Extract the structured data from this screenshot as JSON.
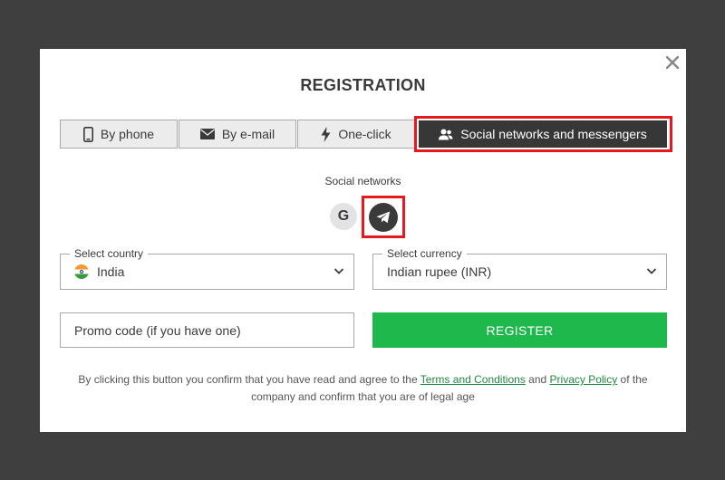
{
  "modal": {
    "title": "REGISTRATION",
    "close_icon": "close-icon"
  },
  "tabs": [
    {
      "label": "By phone",
      "icon": "phone-icon"
    },
    {
      "label": "By e-mail",
      "icon": "envelope-icon"
    },
    {
      "label": "One-click",
      "icon": "lightning-icon"
    },
    {
      "label": "Social networks and messengers",
      "icon": "users-icon",
      "active": true
    }
  ],
  "social": {
    "label": "Social networks",
    "buttons": [
      {
        "name": "google",
        "glyph": "G"
      },
      {
        "name": "telegram",
        "icon": "telegram-icon"
      }
    ]
  },
  "country": {
    "legend": "Select country",
    "value": "India"
  },
  "currency": {
    "legend": "Select currency",
    "value": "Indian rupee (INR)"
  },
  "promo": {
    "placeholder": "Promo code (if you have one)"
  },
  "register": {
    "label": "REGISTER"
  },
  "terms": {
    "before": "By clicking this button you confirm that you have read and agree to the ",
    "terms_link": "Terms and Conditions",
    "middle": " and ",
    "privacy_link": "Privacy Policy",
    "after": " of the company and confirm that you are of legal age"
  },
  "colors": {
    "background": "#3f3f3f",
    "active_tab": "#373737",
    "highlight": "#e8181f",
    "register": "#1fb84c",
    "link": "#1e8a3e"
  }
}
